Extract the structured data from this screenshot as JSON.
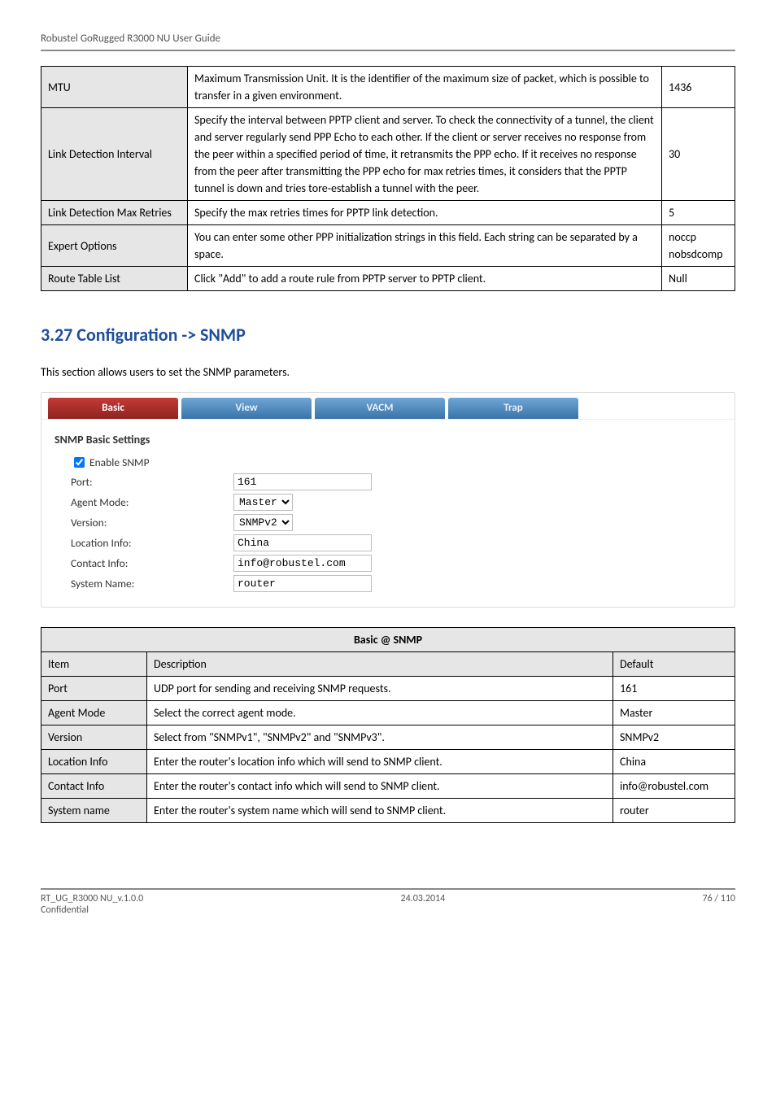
{
  "header": {
    "title": "Robustel GoRugged R3000 NU User Guide"
  },
  "table1": {
    "rows": [
      {
        "name": "MTU",
        "desc": "Maximum Transmission Unit. It is the identifier of the maximum size of packet, which is possible to transfer in a given environment.",
        "default": "1436"
      },
      {
        "name": "Link Detection Interval",
        "desc": "Specify the interval between PPTP client and server.\nTo check the connectivity of a tunnel, the client and server regularly send PPP Echo to each other. If the client or server receives no response from the peer within a specified period of time, it retransmits the PPP echo. If it receives no response from the peer after transmitting the PPP echo for max retries times, it considers that the PPTP tunnel is down and tries tore-establish a tunnel with the peer.",
        "default": "30"
      },
      {
        "name": "Link Detection Max Retries",
        "desc": "Specify the max retries times for PPTP link detection.",
        "default": "5"
      },
      {
        "name": "Expert Options",
        "desc": "You can enter some other PPP initialization strings in this field. Each string can be separated by a space.",
        "default": "noccp nobsdcomp"
      },
      {
        "name": "Route Table List",
        "desc": "Click \"Add\" to add a route rule from PPTP server to PPTP client.",
        "default": "Null"
      }
    ]
  },
  "section": {
    "title": "3.27  Configuration -> SNMP",
    "intro": "This section allows users to set the SNMP parameters."
  },
  "snmp_panel": {
    "tabs": [
      "Basic",
      "View",
      "VACM",
      "Trap"
    ],
    "heading": "SNMP Basic Settings",
    "enable_label": "Enable SNMP",
    "fields": {
      "port_label": "Port:",
      "port_value": "161",
      "agent_label": "Agent Mode:",
      "agent_value": "Master",
      "version_label": "Version:",
      "version_value": "SNMPv2",
      "location_label": "Location Info:",
      "location_value": "China",
      "contact_label": "Contact Info:",
      "contact_value": "info@robustel.com",
      "system_label": "System Name:",
      "system_value": "router"
    }
  },
  "table2": {
    "title": "Basic @ SNMP",
    "header": {
      "item": "Item",
      "desc": "Description",
      "default": "Default"
    },
    "rows": [
      {
        "item": "Port",
        "desc": "UDP port for sending and receiving SNMP requests.",
        "default": "161"
      },
      {
        "item": "Agent Mode",
        "desc": "Select the correct agent mode.",
        "default": "Master"
      },
      {
        "item": "Version",
        "desc": "Select from \"SNMPv1\", \"SNMPv2\" and \"SNMPv3\".",
        "default": "SNMPv2"
      },
      {
        "item": "Location Info",
        "desc": "Enter the router's location info which will send to SNMP client.",
        "default": "China"
      },
      {
        "item": "Contact Info",
        "desc": "Enter the router's contact info which will send to SNMP client.",
        "default": "info@robustel.com"
      },
      {
        "item": "System name",
        "desc": "Enter the router's system name which will send to SNMP client.",
        "default": "router"
      }
    ]
  },
  "footer": {
    "left": "RT_UG_R3000 NU_v.1.0.0",
    "center": "24.03.2014",
    "right": "76 / 110",
    "confidential": "Confidential"
  }
}
